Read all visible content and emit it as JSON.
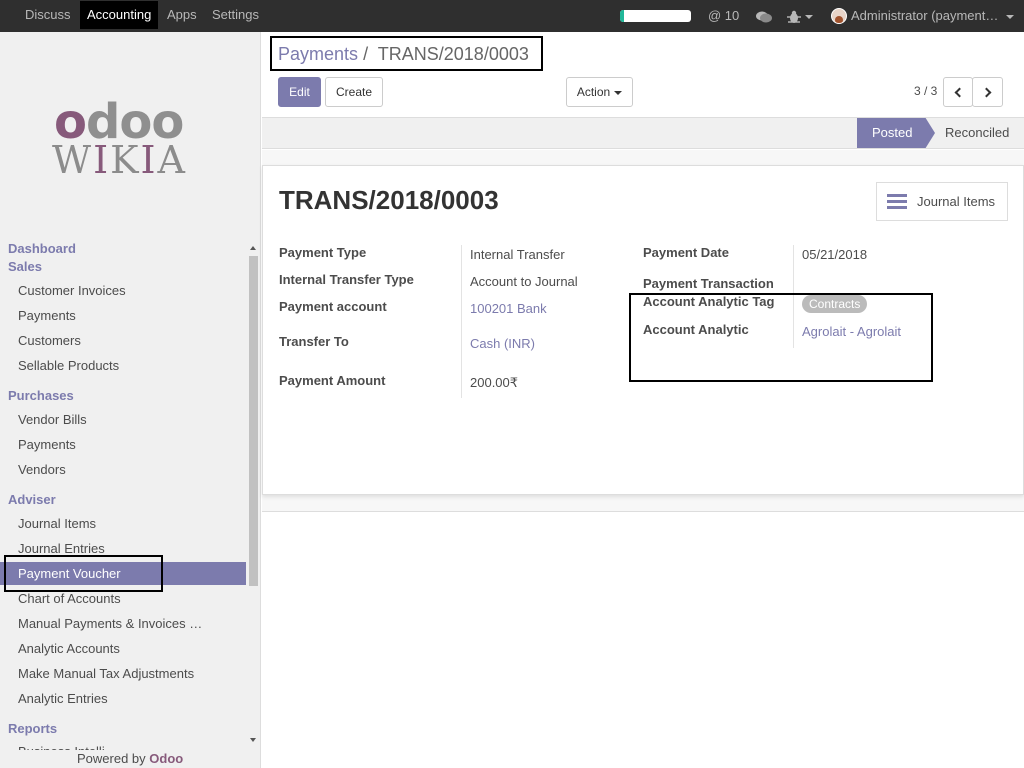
{
  "topbar": {
    "menus": [
      "Discuss",
      "Accounting",
      "Apps",
      "Settings"
    ],
    "progress_fraction": 0.06,
    "messages_count": "@ 10",
    "user": "Administrator (payment…"
  },
  "sidebar": {
    "logo_top": "odoo",
    "logo_bottom": "WIKIA",
    "sections": {
      "dashboard": "Dashboard",
      "sales": "Sales",
      "purchases": "Purchases",
      "adviser": "Adviser",
      "reports": "Reports"
    },
    "sales_items": [
      "Customer Invoices",
      "Payments",
      "Customers",
      "Sellable Products"
    ],
    "purchases_items": [
      "Vendor Bills",
      "Payments",
      "Vendors"
    ],
    "adviser_items": [
      "Journal Items",
      "Journal Entries",
      "Payment Voucher",
      "Chart of Accounts",
      "Manual Payments & Invoices …",
      "Analytic Accounts",
      "Make Manual Tax Adjustments",
      "Analytic Entries"
    ],
    "reports_partial": "Business Intelli",
    "powered_by": "Powered by",
    "powered_brand": "Odoo"
  },
  "breadcrumb": {
    "parent": "Payments",
    "separator": "/",
    "current": "TRANS/2018/0003"
  },
  "buttons": {
    "edit": "Edit",
    "create": "Create",
    "action": "Action"
  },
  "pager": "3 / 3",
  "status": {
    "posted": "Posted",
    "reconciled": "Reconciled"
  },
  "record": {
    "title": "TRANS/2018/0003",
    "journal_items": "Journal Items",
    "payment_type_label": "Payment Type",
    "payment_type": "Internal Transfer",
    "internal_transfer_type_label": "Internal Transfer Type",
    "internal_transfer_type": "Account to Journal",
    "payment_account_label": "Payment account",
    "payment_account": "100201 Bank",
    "transfer_to_label": "Transfer To",
    "transfer_to": "Cash (INR)",
    "payment_amount_label": "Payment Amount",
    "payment_amount": "200.00₹",
    "payment_date_label": "Payment Date",
    "payment_date": "05/21/2018",
    "payment_transaction_label": "Payment Transaction",
    "analytic_tag_label": "Account Analytic Tag",
    "analytic_tag": "Contracts",
    "analytic_label": "Account Analytic",
    "analytic": "Agrolait - Agrolait"
  },
  "colors": {
    "brand": "#7c7bad",
    "topbar": "#2f2f2f",
    "odoo_purple": "#875a7b"
  }
}
